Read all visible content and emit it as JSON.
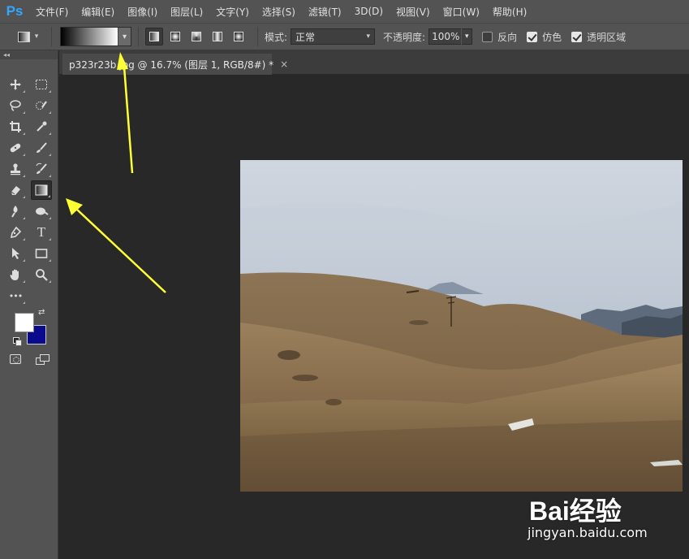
{
  "app": {
    "logo": "Ps"
  },
  "menu": [
    "文件(F)",
    "编辑(E)",
    "图像(I)",
    "图层(L)",
    "文字(Y)",
    "选择(S)",
    "滤镜(T)",
    "3D(D)",
    "视图(V)",
    "窗口(W)",
    "帮助(H)"
  ],
  "options": {
    "mode_label": "模式:",
    "mode_value": "正常",
    "opacity_label": "不透明度:",
    "opacity_value": "100%",
    "reverse_label": "反向",
    "reverse_checked": false,
    "dither_label": "仿色",
    "dither_checked": true,
    "transparency_label": "透明区域",
    "transparency_checked": true,
    "gradient_preview": {
      "start_color": "#000000",
      "end_color": "#ffffff"
    }
  },
  "tools_panel": {
    "collapse_glyph": "◂◂",
    "icons": [
      "move-icon",
      "marquee-icon",
      "lasso-icon",
      "quick-select-icon",
      "crop-icon",
      "eyedropper-icon",
      "healing-brush-icon",
      "brush-icon",
      "clone-stamp-icon",
      "history-brush-icon",
      "eraser-icon",
      "gradient-icon",
      "blur-icon",
      "dodge-icon",
      "pen-icon",
      "type-icon",
      "path-select-icon",
      "rectangle-icon",
      "hand-icon",
      "zoom-icon",
      "more-tools-icon"
    ],
    "type_tool_glyph": "T",
    "more_glyph": "•••",
    "foreground_color": "#ffffff",
    "background_color": "#0a0a8c"
  },
  "document": {
    "tab_title": "p323r23b.jpg @ 16.7% (图层 1, RGB/8#) *",
    "close_glyph": "×"
  },
  "watermark": {
    "logo_text": "Bai经验",
    "url": "jingyan.baidu.com"
  },
  "colors": {
    "accent": "#31a8ff",
    "annotation_arrow": "#ffff33",
    "panel_bg": "#535353",
    "canvas_bg": "#282828"
  }
}
